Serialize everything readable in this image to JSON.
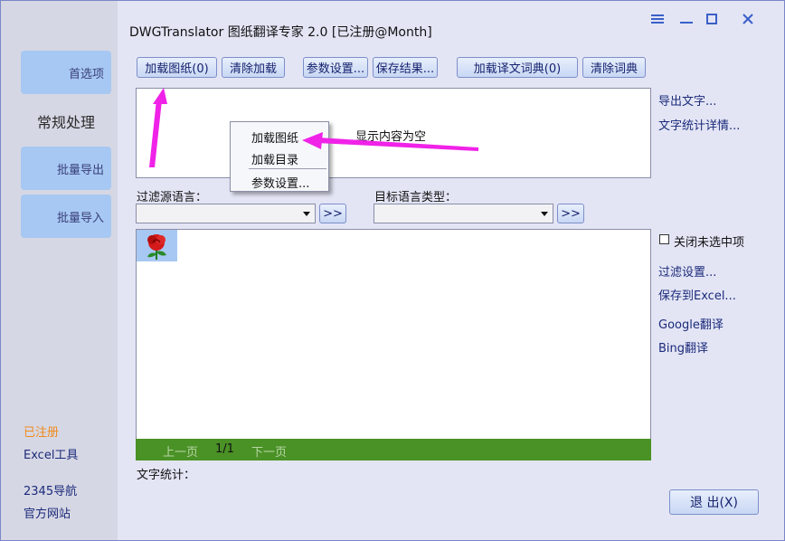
{
  "window": {
    "title": "DWGTranslator 图纸翻译专家 2.0 [已注册@Month]",
    "controls": {
      "menu": "≡",
      "minimize": "—",
      "maximize": "□",
      "close": "✕"
    }
  },
  "sidebar": {
    "items": [
      {
        "label": "首选项"
      },
      {
        "label": "常规处理"
      },
      {
        "label": "批量导出"
      },
      {
        "label": "批量导入"
      }
    ],
    "links": [
      {
        "label": "已注册"
      },
      {
        "label": "Excel工具"
      },
      {
        "label": "2345导航"
      },
      {
        "label": "官方网站"
      }
    ]
  },
  "toolbar": {
    "load_drawing": "加载图纸(0)",
    "clear_load": "清除加载",
    "params": "参数设置...",
    "save_result": "保存结果...",
    "load_dict": "加载译文词典(0)",
    "clear_dict": "清除词典"
  },
  "display": {
    "empty_text": "显示内容为空"
  },
  "context_menu": {
    "items": [
      "加载图纸",
      "加载目录",
      "参数设置..."
    ]
  },
  "right_links": {
    "export_text": "导出文字...",
    "text_stats_detail": "文字统计详情...",
    "close_unselected": "关闭未选中项",
    "filter_settings": "过滤设置...",
    "save_excel": "保存到Excel...",
    "google": "Google翻译",
    "bing": "Bing翻译"
  },
  "filters": {
    "source_label": "过滤源语言：",
    "target_label": "目标语言类型：",
    "source_value": "",
    "target_value": "",
    "go": ">>"
  },
  "pager": {
    "prev": "上一页",
    "page": "1/1",
    "next": "下一页"
  },
  "stats": {
    "label": "文字统计："
  },
  "exit_button": "退 出(X)",
  "colors": {
    "accent": "#a7c8f2",
    "pager": "#4a9126",
    "annotation_arrow": "#f022e8"
  }
}
